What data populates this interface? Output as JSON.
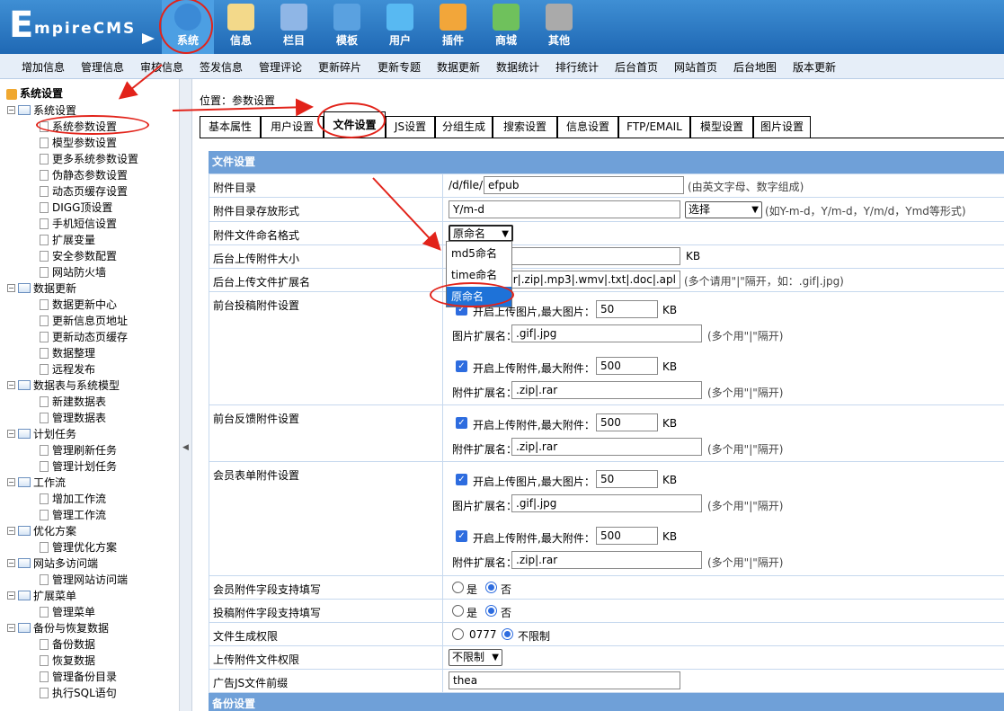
{
  "logo": {
    "big_letter": "E",
    "text": "mpireCMS"
  },
  "topnav": [
    {
      "label": "系统",
      "icon": "globe-icon",
      "active": true
    },
    {
      "label": "信息",
      "icon": "notepad-icon"
    },
    {
      "label": "栏目",
      "icon": "folder-icon"
    },
    {
      "label": "模板",
      "icon": "window-icon"
    },
    {
      "label": "用户",
      "icon": "user-icon"
    },
    {
      "label": "插件",
      "icon": "tools-icon"
    },
    {
      "label": "商城",
      "icon": "card-icon"
    },
    {
      "label": "其他",
      "icon": "gear-icon"
    }
  ],
  "menubar": [
    "增加信息",
    "管理信息",
    "审核信息",
    "签发信息",
    "管理评论",
    "更新碎片",
    "更新专题",
    "数据更新",
    "数据统计",
    "排行统计",
    "后台首页",
    "网站首页",
    "后台地图",
    "版本更新"
  ],
  "sidebar": {
    "root": "系统设置",
    "groups": [
      {
        "label": "系统设置",
        "items": [
          "系统参数设置",
          "模型参数设置",
          "更多系统参数设置",
          "伪静态参数设置",
          "动态页缓存设置",
          "DIGG顶设置",
          "手机短信设置",
          "扩展变量",
          "安全参数配置",
          "网站防火墙"
        ]
      },
      {
        "label": "数据更新",
        "items": [
          "数据更新中心",
          "更新信息页地址",
          "更新动态页缓存",
          "数据整理",
          "远程发布"
        ]
      },
      {
        "label": "数据表与系统模型",
        "items": [
          "新建数据表",
          "管理数据表"
        ]
      },
      {
        "label": "计划任务",
        "items": [
          "管理刷新任务",
          "管理计划任务"
        ]
      },
      {
        "label": "工作流",
        "items": [
          "增加工作流",
          "管理工作流"
        ]
      },
      {
        "label": "优化方案",
        "items": [
          "管理优化方案"
        ]
      },
      {
        "label": "网站多访问端",
        "items": [
          "管理网站访问端"
        ]
      },
      {
        "label": "扩展菜单",
        "items": [
          "管理菜单"
        ]
      },
      {
        "label": "备份与恢复数据",
        "items": [
          "备份数据",
          "恢复数据",
          "管理备份目录",
          "执行SQL语句"
        ]
      }
    ]
  },
  "crumb": "位置：参数设置",
  "tabs": [
    "基本属性",
    "用户设置",
    "文件设置",
    "JS设置",
    "分组生成",
    "搜索设置",
    "信息设置",
    "FTP/EMAIL",
    "模型设置",
    "图片设置"
  ],
  "section_title": "文件设置",
  "section2_title": "备份设置",
  "rows": {
    "attach_dir": {
      "label": "附件目录",
      "prefix": "/d/file/",
      "value": "efpub",
      "hint": "(由英文字母、数字组成)"
    },
    "attach_dir_form": {
      "label": "附件目录存放形式",
      "value": "Y/m-d",
      "select": "选择",
      "hint": "(如Y-m-d，Y/m-d，Y/m/d，Ymd等形式)"
    },
    "attach_name": {
      "label": "附件文件命名格式",
      "select": "原命名",
      "options": [
        "md5命名",
        "time命名",
        "原命名"
      ]
    },
    "admin_max": {
      "label": "后台上传附件大小",
      "unit": "KB"
    },
    "admin_ext": {
      "label": "后台上传文件扩展名",
      "value": "|.rar|.zip|.mp3|.wmv|.txt|.doc|.apl",
      "hint": "(多个请用\"|\"隔开，如：.gif|.jpg)"
    },
    "front_post": {
      "label": "前台投稿附件设置",
      "img_check": "开启上传图片,最大图片：",
      "img_size": "50",
      "unit": "KB",
      "img_ext_label": "图片扩展名：",
      "img_ext": ".gif|.jpg",
      "hint": "(多个用\"|\"隔开)",
      "file_check": "开启上传附件,最大附件：",
      "file_size": "500",
      "file_ext_label": "附件扩展名：",
      "file_ext": ".zip|.rar"
    },
    "front_feedback": {
      "label": "前台反馈附件设置",
      "file_check": "开启上传附件,最大附件：",
      "file_size": "500",
      "unit": "KB",
      "file_ext_label": "附件扩展名：",
      "file_ext": ".zip|.rar",
      "hint": "(多个用\"|\"隔开)"
    },
    "member_form": {
      "label": "会员表单附件设置",
      "img_check": "开启上传图片,最大图片：",
      "img_size": "50",
      "unit": "KB",
      "img_ext_label": "图片扩展名：",
      "img_ext": ".gif|.jpg",
      "hint": "(多个用\"|\"隔开)",
      "file_check": "开启上传附件,最大附件：",
      "file_size": "500",
      "file_ext_label": "附件扩展名：",
      "file_ext": ".zip|.rar"
    },
    "member_field": {
      "label": "会员附件字段支持填写",
      "yes": "是",
      "no": "否"
    },
    "post_field": {
      "label": "投稿附件字段支持填写",
      "yes": "是",
      "no": "否"
    },
    "file_perm": {
      "label": "文件生成权限",
      "opt1": "0777",
      "opt2": "不限制"
    },
    "upload_perm": {
      "label": "上传附件文件权限",
      "select": "不限制"
    },
    "ad_js": {
      "label": "广告JS文件前缀",
      "value": "thea"
    }
  }
}
